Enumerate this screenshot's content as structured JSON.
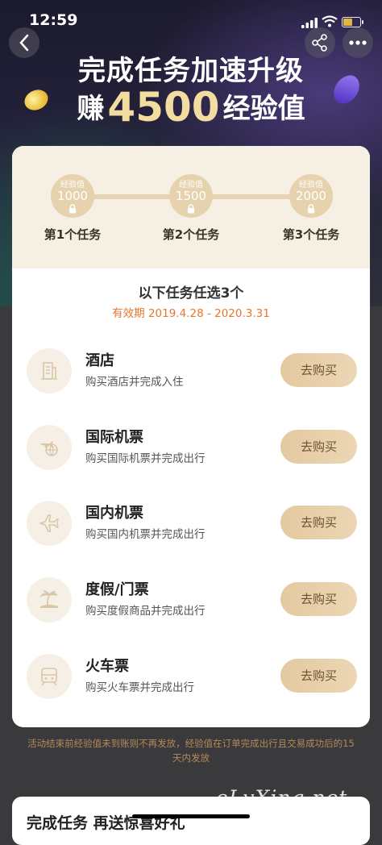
{
  "status_bar": {
    "time": "12:59"
  },
  "hero": {
    "title_line1": "完成任务加速升级",
    "title_prefix": "赚",
    "title_amount": "4500",
    "title_suffix": "经验值"
  },
  "progress": {
    "nodes": [
      {
        "label": "经验值",
        "value": "1000",
        "step": "第1个任务",
        "locked": true
      },
      {
        "label": "经验值",
        "value": "1500",
        "step": "第2个任务",
        "locked": true
      },
      {
        "label": "经验值",
        "value": "2000",
        "step": "第3个任务",
        "locked": true
      }
    ]
  },
  "tasks_header": {
    "title": "以下任务任选3个",
    "validity": "有效期 2019.4.28 - 2020.3.31"
  },
  "tasks": [
    {
      "name": "酒店",
      "desc": "购买酒店并完成入住",
      "button": "去购买",
      "icon": "hotel-icon"
    },
    {
      "name": "国际机票",
      "desc": "购买国际机票并完成出行",
      "button": "去购买",
      "icon": "globe-plane-icon"
    },
    {
      "name": "国内机票",
      "desc": "购买国内机票并完成出行",
      "button": "去购买",
      "icon": "plane-icon"
    },
    {
      "name": "度假/门票",
      "desc": "购买度假商品并完成出行",
      "button": "去购买",
      "icon": "palm-beach-icon"
    },
    {
      "name": "火车票",
      "desc": "购买火车票并完成出行",
      "button": "去购买",
      "icon": "train-icon"
    }
  ],
  "footnote": "活动结束前经验值未到账则不再发放，经验值在订单完成出行且交易成功后的15天内发放",
  "bottom_card": {
    "title": "完成任务 再送惊喜好礼"
  },
  "watermark": "eLvXing.net",
  "colors": {
    "accent": "#e4c9a0",
    "validity": "#e8762b",
    "footnote": "#b38a58"
  }
}
